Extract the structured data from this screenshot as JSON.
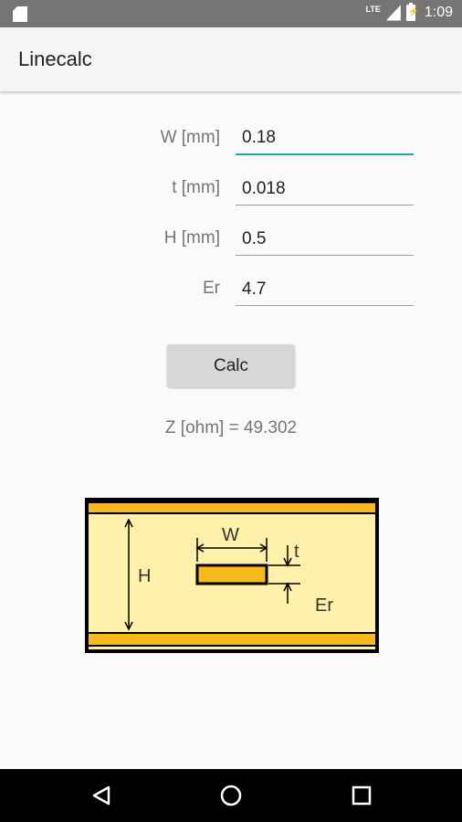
{
  "status_bar": {
    "network": "LTE",
    "time": "1:09"
  },
  "app_bar": {
    "title": "Linecalc"
  },
  "form": {
    "fields": [
      {
        "label": "W [mm]",
        "value": "0.18"
      },
      {
        "label": "t [mm]",
        "value": "0.018"
      },
      {
        "label": "H [mm]",
        "value": "0.5"
      },
      {
        "label": "Er",
        "value": "4.7"
      }
    ]
  },
  "calc_button": {
    "label": "Calc"
  },
  "result": {
    "text": "Z [ohm] = 49.302"
  },
  "diagram": {
    "labels": {
      "w": "W",
      "t": "t",
      "h": "H",
      "er": "Er"
    },
    "colors": {
      "metal": "#f9b91a",
      "dielectric": "#fff0aa",
      "outline": "#000000"
    }
  },
  "nav_bar": {
    "icons": [
      "back-icon",
      "home-icon",
      "recents-icon"
    ]
  }
}
